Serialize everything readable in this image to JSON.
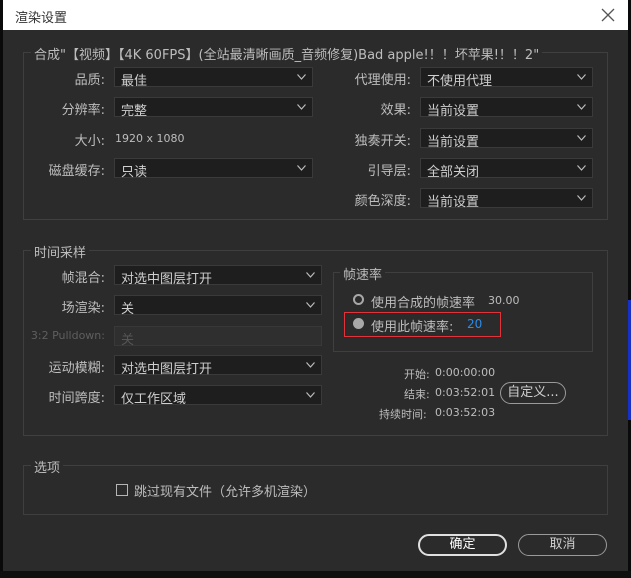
{
  "window": {
    "title": "渲染设置"
  },
  "composition": {
    "title": "合成\"【视频】【4K 60FPS】(全站最清晰画质_音频修复)Bad apple!！！坏苹果!！！2\"",
    "quality_label": "品质:",
    "quality_value": "最佳",
    "resolution_label": "分辨率:",
    "resolution_value": "完整",
    "size_label": "大小:",
    "size_value": "1920 x 1080",
    "disk_cache_label": "磁盘缓存:",
    "disk_cache_value": "只读",
    "proxy_label": "代理使用:",
    "proxy_value": "不使用代理",
    "effects_label": "效果:",
    "effects_value": "当前设置",
    "solo_label": "独奏开关:",
    "solo_value": "当前设置",
    "guide_label": "引导层:",
    "guide_value": "全部关闭",
    "color_depth_label": "颜色深度:",
    "color_depth_value": "当前设置"
  },
  "time_sampling": {
    "title": "时间采样",
    "frame_blend_label": "帧混合:",
    "frame_blend_value": "对选中图层打开",
    "field_render_label": "场渲染:",
    "field_render_value": "关",
    "pulldown_label": "3:2 Pulldown:",
    "pulldown_value": "关",
    "motion_blur_label": "运动模糊:",
    "motion_blur_value": "对选中图层打开",
    "time_span_label": "时间跨度:",
    "time_span_value": "仅工作区域",
    "frame_rate": {
      "title": "帧速率",
      "use_comp_label": "使用合成的帧速率",
      "comp_rate": "30.00",
      "use_this_label": "使用此帧速率:",
      "this_rate": "20",
      "selected": "use_this"
    },
    "start_label": "开始:",
    "start_value": "0:00:00:00",
    "end_label": "结束:",
    "end_value": "0:03:52:01",
    "duration_label": "持续时间:",
    "duration_value": "0:03:52:03",
    "custom_button": "自定义..."
  },
  "options": {
    "title": "选项",
    "skip_existing_label": "跳过现有文件（允许多机渲染）",
    "skip_existing_checked": false
  },
  "buttons": {
    "ok": "确定",
    "cancel": "取消"
  },
  "colors": {
    "accent_blue": "#2d8ceb",
    "highlight_red": "#e0343a"
  }
}
